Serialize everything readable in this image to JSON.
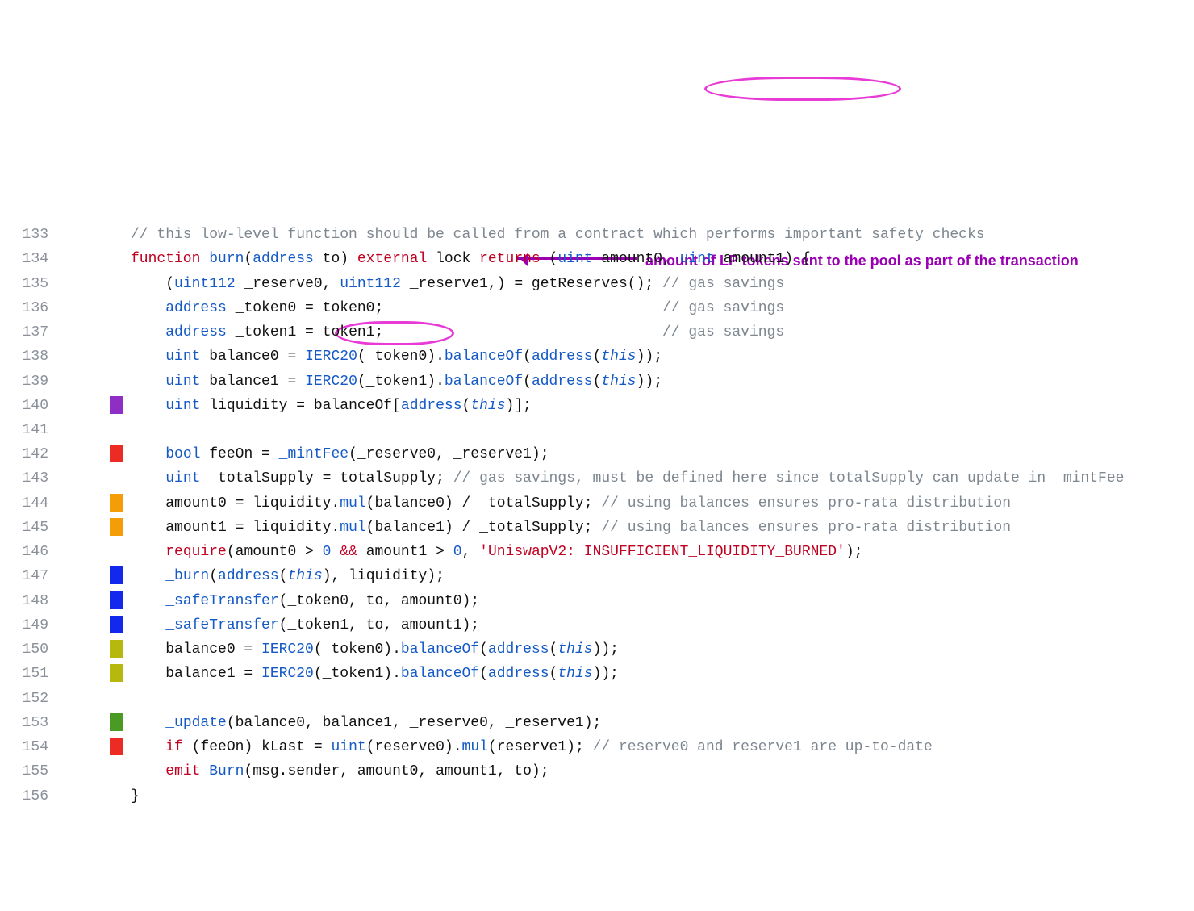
{
  "annotation": {
    "arrow_text": "amount of LP tokens sent to the pool as part of the transaction"
  },
  "lines": [
    {
      "n": "133",
      "mk": "",
      "ind": 0,
      "toks": [
        {
          "c": "c-cmt",
          "t": "// this low-level function should be called from a contract which performs important safety checks"
        }
      ]
    },
    {
      "n": "134",
      "mk": "",
      "ind": 0,
      "toks": [
        {
          "c": "c-kw",
          "t": "function "
        },
        {
          "c": "c-id",
          "t": "burn"
        },
        {
          "c": "c-plain",
          "t": "("
        },
        {
          "c": "c-ty",
          "t": "address"
        },
        {
          "c": "c-plain",
          "t": " to) "
        },
        {
          "c": "c-kw",
          "t": "external "
        },
        {
          "c": "c-plain",
          "t": "lock "
        },
        {
          "c": "c-kw",
          "t": "returns "
        },
        {
          "c": "c-plain",
          "t": "("
        },
        {
          "c": "c-ty",
          "t": "uint"
        },
        {
          "c": "c-plain",
          "t": " amount0, "
        },
        {
          "c": "c-ty",
          "t": "uint"
        },
        {
          "c": "c-plain",
          "t": " amount1) {"
        }
      ]
    },
    {
      "n": "135",
      "mk": "",
      "ind": 1,
      "toks": [
        {
          "c": "c-plain",
          "t": "("
        },
        {
          "c": "c-ty",
          "t": "uint112"
        },
        {
          "c": "c-plain",
          "t": " _reserve0, "
        },
        {
          "c": "c-ty",
          "t": "uint112"
        },
        {
          "c": "c-plain",
          "t": " _reserve1,) = getReserves(); "
        },
        {
          "c": "c-cmt",
          "t": "// gas savings"
        }
      ]
    },
    {
      "n": "136",
      "mk": "",
      "ind": 1,
      "toks": [
        {
          "c": "c-ty",
          "t": "address"
        },
        {
          "c": "c-plain",
          "t": " _token0 = token0;                                "
        },
        {
          "c": "c-cmt",
          "t": "// gas savings"
        }
      ]
    },
    {
      "n": "137",
      "mk": "",
      "ind": 1,
      "toks": [
        {
          "c": "c-ty",
          "t": "address"
        },
        {
          "c": "c-plain",
          "t": " _token1 = token1;                                "
        },
        {
          "c": "c-cmt",
          "t": "// gas savings"
        }
      ]
    },
    {
      "n": "138",
      "mk": "",
      "ind": 1,
      "toks": [
        {
          "c": "c-ty",
          "t": "uint"
        },
        {
          "c": "c-plain",
          "t": " balance0 = "
        },
        {
          "c": "c-id",
          "t": "IERC20"
        },
        {
          "c": "c-plain",
          "t": "(_token0)."
        },
        {
          "c": "c-id",
          "t": "balanceOf"
        },
        {
          "c": "c-plain",
          "t": "("
        },
        {
          "c": "c-ty",
          "t": "address"
        },
        {
          "c": "c-plain",
          "t": "("
        },
        {
          "c": "c-th",
          "t": "this"
        },
        {
          "c": "c-plain",
          "t": "));"
        }
      ]
    },
    {
      "n": "139",
      "mk": "",
      "ind": 1,
      "toks": [
        {
          "c": "c-ty",
          "t": "uint"
        },
        {
          "c": "c-plain",
          "t": " balance1 = "
        },
        {
          "c": "c-id",
          "t": "IERC20"
        },
        {
          "c": "c-plain",
          "t": "(_token1)."
        },
        {
          "c": "c-id",
          "t": "balanceOf"
        },
        {
          "c": "c-plain",
          "t": "("
        },
        {
          "c": "c-ty",
          "t": "address"
        },
        {
          "c": "c-plain",
          "t": "("
        },
        {
          "c": "c-th",
          "t": "this"
        },
        {
          "c": "c-plain",
          "t": "));"
        }
      ]
    },
    {
      "n": "140",
      "mk": "mk-purple",
      "ind": 1,
      "toks": [
        {
          "c": "c-ty",
          "t": "uint"
        },
        {
          "c": "c-plain",
          "t": " liquidity = balanceOf["
        },
        {
          "c": "c-ty",
          "t": "address"
        },
        {
          "c": "c-plain",
          "t": "("
        },
        {
          "c": "c-th",
          "t": "this"
        },
        {
          "c": "c-plain",
          "t": ")];"
        }
      ]
    },
    {
      "n": "141",
      "mk": "",
      "ind": 0,
      "toks": [
        {
          "c": "c-plain",
          "t": ""
        }
      ]
    },
    {
      "n": "142",
      "mk": "mk-red",
      "ind": 1,
      "toks": [
        {
          "c": "c-ty",
          "t": "bool"
        },
        {
          "c": "c-plain",
          "t": " feeOn = "
        },
        {
          "c": "c-id",
          "t": "_mintFee"
        },
        {
          "c": "c-plain",
          "t": "(_reserve0, _reserve1);"
        }
      ]
    },
    {
      "n": "143",
      "mk": "",
      "ind": 1,
      "toks": [
        {
          "c": "c-ty",
          "t": "uint"
        },
        {
          "c": "c-plain",
          "t": " _totalSupply = totalSupply; "
        },
        {
          "c": "c-cmt",
          "t": "// gas savings, must be defined here since totalSupply can update in _mintFee"
        }
      ]
    },
    {
      "n": "144",
      "mk": "mk-orange",
      "ind": 1,
      "toks": [
        {
          "c": "c-plain",
          "t": "amount0 = liquidity."
        },
        {
          "c": "c-id",
          "t": "mul"
        },
        {
          "c": "c-plain",
          "t": "(balance0) / _totalSupply; "
        },
        {
          "c": "c-cmt",
          "t": "// using balances ensures pro-rata distribution"
        }
      ]
    },
    {
      "n": "145",
      "mk": "mk-orange",
      "ind": 1,
      "toks": [
        {
          "c": "c-plain",
          "t": "amount1 = liquidity."
        },
        {
          "c": "c-id",
          "t": "mul"
        },
        {
          "c": "c-plain",
          "t": "(balance1) / _totalSupply; "
        },
        {
          "c": "c-cmt",
          "t": "// using balances ensures pro-rata distribution"
        }
      ]
    },
    {
      "n": "146",
      "mk": "",
      "ind": 1,
      "toks": [
        {
          "c": "c-kw",
          "t": "require"
        },
        {
          "c": "c-plain",
          "t": "(amount0 > "
        },
        {
          "c": "c-num",
          "t": "0"
        },
        {
          "c": "c-plain",
          "t": " "
        },
        {
          "c": "c-kw",
          "t": "&&"
        },
        {
          "c": "c-plain",
          "t": " amount1 > "
        },
        {
          "c": "c-num",
          "t": "0"
        },
        {
          "c": "c-plain",
          "t": ", "
        },
        {
          "c": "c-str",
          "t": "'UniswapV2: INSUFFICIENT_LIQUIDITY_BURNED'"
        },
        {
          "c": "c-plain",
          "t": ");"
        }
      ]
    },
    {
      "n": "147",
      "mk": "mk-blue",
      "ind": 1,
      "toks": [
        {
          "c": "c-id",
          "t": "_burn"
        },
        {
          "c": "c-plain",
          "t": "("
        },
        {
          "c": "c-ty",
          "t": "address"
        },
        {
          "c": "c-plain",
          "t": "("
        },
        {
          "c": "c-th",
          "t": "this"
        },
        {
          "c": "c-plain",
          "t": "), liquidity);"
        }
      ]
    },
    {
      "n": "148",
      "mk": "mk-blue",
      "ind": 1,
      "toks": [
        {
          "c": "c-id",
          "t": "_safeTransfer"
        },
        {
          "c": "c-plain",
          "t": "(_token0, to, amount0);"
        }
      ]
    },
    {
      "n": "149",
      "mk": "mk-blue",
      "ind": 1,
      "toks": [
        {
          "c": "c-id",
          "t": "_safeTransfer"
        },
        {
          "c": "c-plain",
          "t": "(_token1, to, amount1);"
        }
      ]
    },
    {
      "n": "150",
      "mk": "mk-olive",
      "ind": 1,
      "toks": [
        {
          "c": "c-plain",
          "t": "balance0 = "
        },
        {
          "c": "c-id",
          "t": "IERC20"
        },
        {
          "c": "c-plain",
          "t": "(_token0)."
        },
        {
          "c": "c-id",
          "t": "balanceOf"
        },
        {
          "c": "c-plain",
          "t": "("
        },
        {
          "c": "c-ty",
          "t": "address"
        },
        {
          "c": "c-plain",
          "t": "("
        },
        {
          "c": "c-th",
          "t": "this"
        },
        {
          "c": "c-plain",
          "t": "));"
        }
      ]
    },
    {
      "n": "151",
      "mk": "mk-olive",
      "ind": 1,
      "toks": [
        {
          "c": "c-plain",
          "t": "balance1 = "
        },
        {
          "c": "c-id",
          "t": "IERC20"
        },
        {
          "c": "c-plain",
          "t": "(_token1)."
        },
        {
          "c": "c-id",
          "t": "balanceOf"
        },
        {
          "c": "c-plain",
          "t": "("
        },
        {
          "c": "c-ty",
          "t": "address"
        },
        {
          "c": "c-plain",
          "t": "("
        },
        {
          "c": "c-th",
          "t": "this"
        },
        {
          "c": "c-plain",
          "t": "));"
        }
      ]
    },
    {
      "n": "152",
      "mk": "",
      "ind": 0,
      "toks": [
        {
          "c": "c-plain",
          "t": ""
        }
      ]
    },
    {
      "n": "153",
      "mk": "mk-green",
      "ind": 1,
      "toks": [
        {
          "c": "c-id",
          "t": "_update"
        },
        {
          "c": "c-plain",
          "t": "(balance0, balance1, _reserve0, _reserve1);"
        }
      ]
    },
    {
      "n": "154",
      "mk": "mk-red",
      "ind": 1,
      "toks": [
        {
          "c": "c-kw",
          "t": "if"
        },
        {
          "c": "c-plain",
          "t": " (feeOn) kLast = "
        },
        {
          "c": "c-ty",
          "t": "uint"
        },
        {
          "c": "c-plain",
          "t": "(reserve0)."
        },
        {
          "c": "c-id",
          "t": "mul"
        },
        {
          "c": "c-plain",
          "t": "(reserve1); "
        },
        {
          "c": "c-cmt",
          "t": "// reserve0 and reserve1 are up-to-date"
        }
      ]
    },
    {
      "n": "155",
      "mk": "",
      "ind": 1,
      "toks": [
        {
          "c": "c-kw",
          "t": "emit "
        },
        {
          "c": "c-id",
          "t": "Burn"
        },
        {
          "c": "c-plain",
          "t": "(msg.sender, amount0, amount1, to);"
        }
      ]
    },
    {
      "n": "156",
      "mk": "",
      "ind": 0,
      "toks": [
        {
          "c": "c-plain",
          "t": "}"
        }
      ]
    }
  ]
}
